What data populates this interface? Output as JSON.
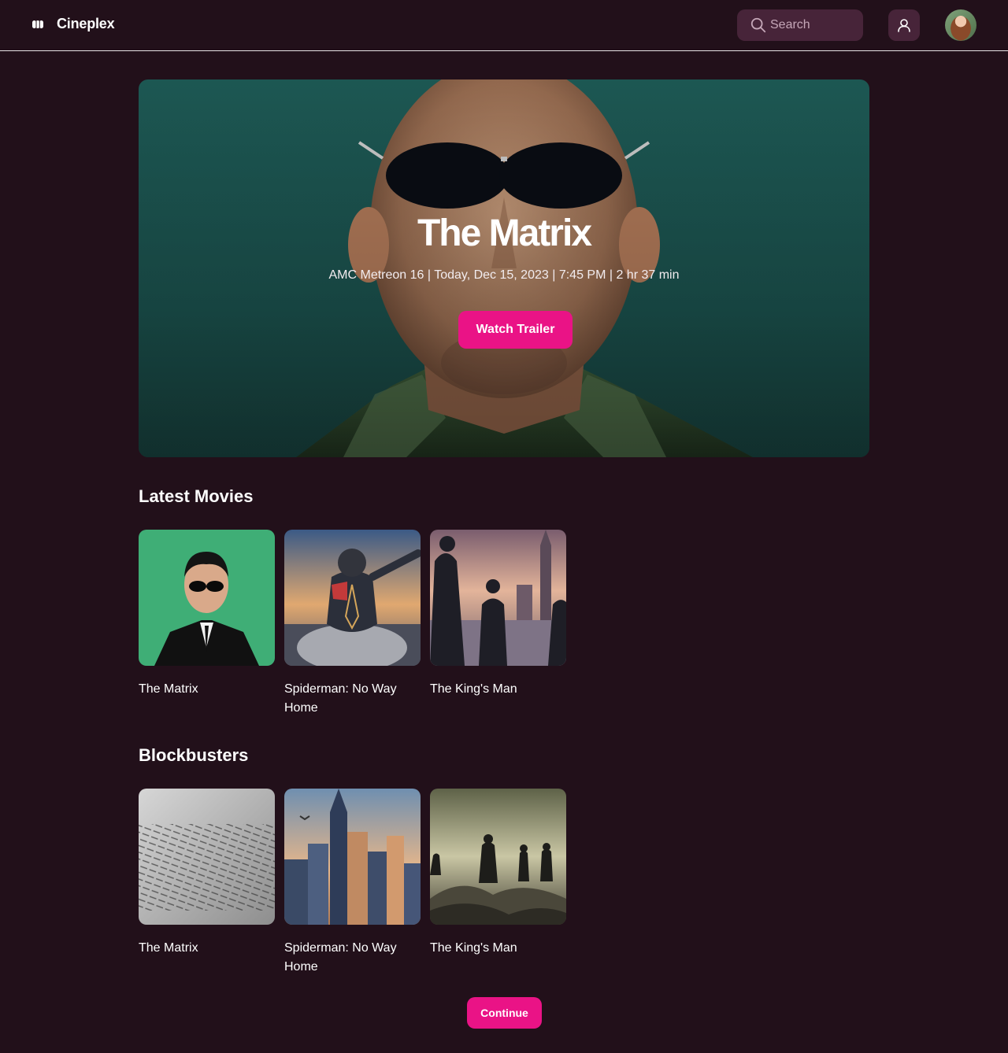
{
  "header": {
    "app_name": "Cineplex",
    "search_placeholder": "Search",
    "icons": {
      "logo": "logo-icon",
      "search": "search-icon",
      "user": "user-icon",
      "avatar": "avatar"
    }
  },
  "hero": {
    "title": "The Matrix",
    "meta": "AMC Metreon 16 | Today, Dec 15, 2023 | 7:45 PM | 2 hr 37 min",
    "button_label": "Watch Trailer"
  },
  "sections": [
    {
      "title": "Latest Movies",
      "movies": [
        {
          "title": "The Matrix"
        },
        {
          "title": "Spiderman: No Way Home"
        },
        {
          "title": "The King's Man"
        }
      ]
    },
    {
      "title": "Blockbusters",
      "movies": [
        {
          "title": "The Matrix"
        },
        {
          "title": "Spiderman: No Way Home"
        },
        {
          "title": "The King's Man"
        }
      ]
    }
  ],
  "continue_label": "Continue",
  "colors": {
    "background": "#22101a",
    "accent": "#ea1386",
    "control_bg": "#472439",
    "text": "#ffffff"
  }
}
